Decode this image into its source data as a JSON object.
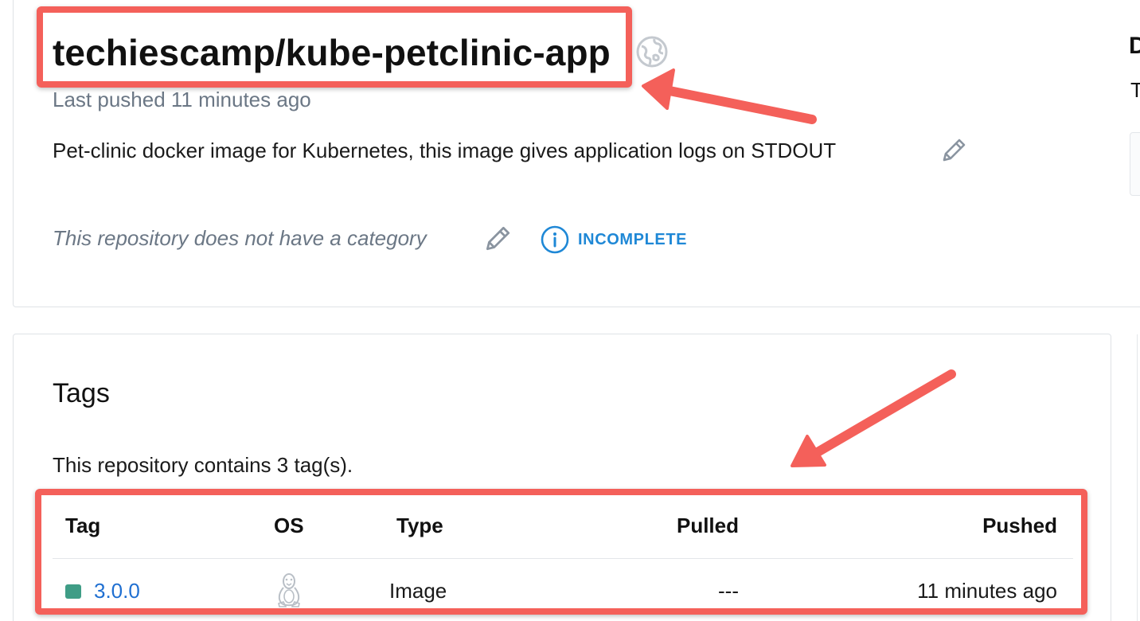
{
  "repository": {
    "name": "techiescamp/kube-petclinic-app",
    "last_pushed": "Last pushed 11 minutes ago",
    "description": "Pet-clinic docker image for Kubernetes, this image gives application logs on STDOUT",
    "category_text": "This repository does not have a category",
    "status_label": "INCOMPLETE",
    "visibility_icon": "globe-icon"
  },
  "side_panel": {
    "heading_fragment": "D",
    "text_fragment": "T"
  },
  "tags": {
    "heading": "Tags",
    "count_text": "This repository contains 3 tag(s).",
    "columns": [
      "Tag",
      "OS",
      "Type",
      "Pulled",
      "Pushed"
    ],
    "rows": [
      {
        "tag": "3.0.0",
        "os_icon": "linux-icon",
        "type": "Image",
        "pulled": "---",
        "pushed": "11 minutes ago"
      }
    ]
  },
  "colors": {
    "highlight": "#f4605a",
    "link": "#1f6fd1",
    "status": "#1f88d6",
    "tag_dot": "#3f9d86",
    "muted_text": "#6b7785"
  }
}
